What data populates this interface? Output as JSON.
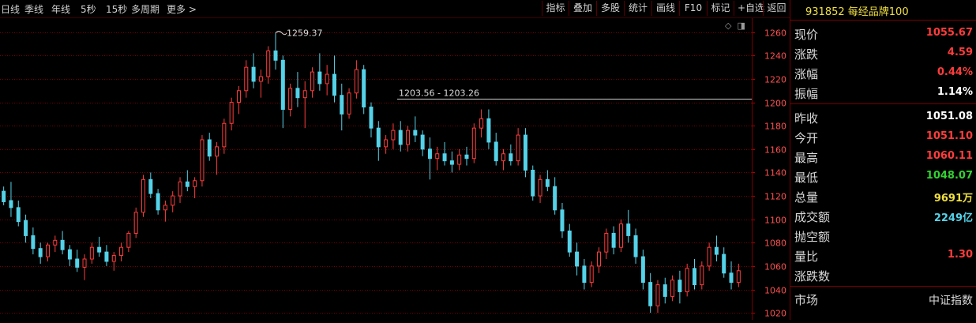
{
  "toolbar": {
    "periods": [
      "日线",
      "季线",
      "年线",
      "5秒",
      "15秒",
      "多周期",
      "更多 >"
    ],
    "buttons": [
      "指标",
      "叠加",
      "多股",
      "统计",
      "画线",
      "F10",
      "标记",
      "+自选",
      "返回"
    ]
  },
  "info": {
    "code": "931852",
    "name": "每经品牌100",
    "rows": [
      {
        "label": "现价",
        "value": "1055.67",
        "color": "#ff3c3c"
      },
      {
        "label": "涨跌",
        "value": "4.59",
        "color": "#ff3c3c"
      },
      {
        "label": "涨幅",
        "value": "0.44%",
        "color": "#ff3c3c"
      },
      {
        "label": "振幅",
        "value": "1.14%",
        "color": "#ffffff"
      },
      {
        "label": "昨收",
        "value": "1051.08",
        "color": "#ffffff"
      },
      {
        "label": "今开",
        "value": "1051.10",
        "color": "#ff3c3c"
      },
      {
        "label": "最高",
        "value": "1060.11",
        "color": "#ff3c3c"
      },
      {
        "label": "最低",
        "value": "1048.07",
        "color": "#32d232"
      },
      {
        "label": "总量",
        "value": "9691万",
        "color": "#f0e040"
      },
      {
        "label": "成交额",
        "value": "2249亿",
        "color": "#54d2e8"
      },
      {
        "label": "抛空额",
        "value": "",
        "color": "#ffffff"
      },
      {
        "label": "量比",
        "value": "1.30",
        "color": "#ff3c3c"
      },
      {
        "label": "涨跌数",
        "value": "",
        "color": "#ffffff"
      },
      {
        "label": "市场",
        "value": "中证指数",
        "color": "#d8d8d8"
      }
    ]
  },
  "chart_data": {
    "type": "candlestick",
    "y_ticks": [
      1020,
      1040,
      1060,
      1080,
      1100,
      1120,
      1140,
      1160,
      1180,
      1200,
      1220,
      1240,
      1260
    ],
    "ylim": [
      1014,
      1272
    ],
    "max_label": "1259.37",
    "range_label": "1203.56 - 1203.26",
    "range_line_value": 1203.4,
    "colors": {
      "up": "#ff3c3c",
      "down": "#54d2e8",
      "grid": "#7a0000"
    },
    "candles": [
      [
        1124,
        1128,
        1112,
        1115
      ],
      [
        1116,
        1132,
        1102,
        1110
      ],
      [
        1110,
        1116,
        1094,
        1098
      ],
      [
        1099,
        1104,
        1080,
        1086
      ],
      [
        1086,
        1093,
        1070,
        1075
      ],
      [
        1075,
        1080,
        1062,
        1068
      ],
      [
        1068,
        1080,
        1064,
        1078
      ],
      [
        1078,
        1086,
        1072,
        1082
      ],
      [
        1082,
        1090,
        1070,
        1074
      ],
      [
        1074,
        1078,
        1060,
        1066
      ],
      [
        1066,
        1074,
        1055,
        1059
      ],
      [
        1059,
        1070,
        1048,
        1066
      ],
      [
        1066,
        1080,
        1062,
        1076
      ],
      [
        1076,
        1085,
        1068,
        1072
      ],
      [
        1072,
        1078,
        1060,
        1064
      ],
      [
        1064,
        1072,
        1056,
        1069
      ],
      [
        1069,
        1080,
        1064,
        1076
      ],
      [
        1076,
        1090,
        1072,
        1088
      ],
      [
        1088,
        1110,
        1084,
        1106
      ],
      [
        1106,
        1138,
        1102,
        1134
      ],
      [
        1134,
        1140,
        1118,
        1122
      ],
      [
        1122,
        1126,
        1104,
        1108
      ],
      [
        1108,
        1116,
        1098,
        1112
      ],
      [
        1112,
        1124,
        1106,
        1120
      ],
      [
        1120,
        1136,
        1114,
        1132
      ],
      [
        1132,
        1142,
        1124,
        1128
      ],
      [
        1128,
        1136,
        1118,
        1133
      ],
      [
        1133,
        1172,
        1128,
        1168
      ],
      [
        1168,
        1174,
        1150,
        1154
      ],
      [
        1154,
        1166,
        1138,
        1162
      ],
      [
        1162,
        1186,
        1156,
        1182
      ],
      [
        1182,
        1204,
        1176,
        1200
      ],
      [
        1200,
        1214,
        1190,
        1210
      ],
      [
        1210,
        1236,
        1204,
        1230
      ],
      [
        1230,
        1242,
        1212,
        1218
      ],
      [
        1218,
        1228,
        1204,
        1222
      ],
      [
        1222,
        1248,
        1216,
        1244
      ],
      [
        1244,
        1259.37,
        1228,
        1236
      ],
      [
        1236,
        1240,
        1178,
        1194
      ],
      [
        1194,
        1216,
        1188,
        1212
      ],
      [
        1212,
        1226,
        1196,
        1204
      ],
      [
        1204,
        1218,
        1178,
        1210
      ],
      [
        1210,
        1230,
        1204,
        1226
      ],
      [
        1226,
        1242,
        1210,
        1216
      ],
      [
        1216,
        1232,
        1206,
        1224
      ],
      [
        1224,
        1240,
        1200,
        1206
      ],
      [
        1206,
        1216,
        1176,
        1190
      ],
      [
        1190,
        1212,
        1186,
        1208
      ],
      [
        1208,
        1236,
        1203.26,
        1228
      ],
      [
        1228,
        1232,
        1190,
        1196
      ],
      [
        1196,
        1200,
        1170,
        1178
      ],
      [
        1178,
        1184,
        1150,
        1162
      ],
      [
        1162,
        1172,
        1156,
        1168
      ],
      [
        1168,
        1182,
        1160,
        1176
      ],
      [
        1176,
        1184,
        1158,
        1164
      ],
      [
        1164,
        1180,
        1158,
        1176
      ],
      [
        1176,
        1188,
        1166,
        1172
      ],
      [
        1172,
        1176,
        1154,
        1160
      ],
      [
        1160,
        1170,
        1134,
        1152
      ],
      [
        1152,
        1162,
        1142,
        1156
      ],
      [
        1156,
        1166,
        1146,
        1150
      ],
      [
        1150,
        1158,
        1140,
        1147
      ],
      [
        1147,
        1160,
        1142,
        1155
      ],
      [
        1155,
        1162,
        1146,
        1152
      ],
      [
        1152,
        1182,
        1148,
        1178
      ],
      [
        1178,
        1194,
        1170,
        1186
      ],
      [
        1186,
        1194,
        1160,
        1166
      ],
      [
        1166,
        1174,
        1146,
        1150
      ],
      [
        1150,
        1160,
        1142,
        1156
      ],
      [
        1156,
        1164,
        1146,
        1150
      ],
      [
        1150,
        1178,
        1146,
        1172
      ],
      [
        1172,
        1178,
        1136,
        1142
      ],
      [
        1142,
        1146,
        1116,
        1120
      ],
      [
        1120,
        1138,
        1114,
        1134
      ],
      [
        1134,
        1142,
        1124,
        1128
      ],
      [
        1128,
        1136,
        1104,
        1108
      ],
      [
        1108,
        1114,
        1084,
        1090
      ],
      [
        1090,
        1096,
        1068,
        1072
      ],
      [
        1072,
        1080,
        1052,
        1060
      ],
      [
        1060,
        1066,
        1040,
        1046
      ],
      [
        1046,
        1064,
        1042,
        1060
      ],
      [
        1060,
        1076,
        1054,
        1072
      ],
      [
        1072,
        1092,
        1066,
        1088
      ],
      [
        1088,
        1094,
        1070,
        1076
      ],
      [
        1076,
        1100,
        1072,
        1096
      ],
      [
        1096,
        1108,
        1080,
        1086
      ],
      [
        1086,
        1092,
        1062,
        1068
      ],
      [
        1068,
        1074,
        1040,
        1046
      ],
      [
        1046,
        1054,
        1020,
        1026
      ],
      [
        1026,
        1048,
        1020,
        1044
      ],
      [
        1044,
        1050,
        1028,
        1034
      ],
      [
        1034,
        1052,
        1030,
        1048
      ],
      [
        1048,
        1056,
        1028,
        1038
      ],
      [
        1038,
        1062,
        1034,
        1058
      ],
      [
        1058,
        1066,
        1040,
        1044
      ],
      [
        1044,
        1064,
        1040,
        1060
      ],
      [
        1060,
        1080,
        1056,
        1076
      ],
      [
        1076,
        1086,
        1064,
        1070
      ],
      [
        1070,
        1076,
        1050,
        1054
      ],
      [
        1054,
        1064,
        1040,
        1046
      ],
      [
        1046,
        1062,
        1042,
        1056
      ]
    ]
  }
}
